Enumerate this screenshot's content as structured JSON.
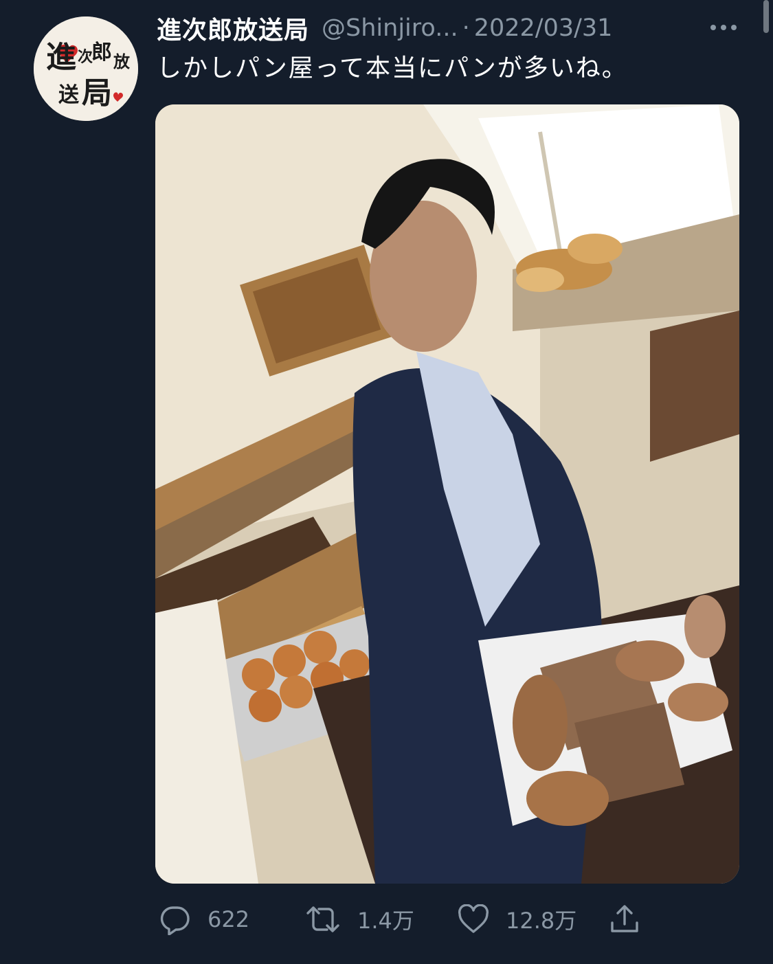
{
  "tweet": {
    "display_name": "進次郎放送局",
    "handle": "@Shinjiro...",
    "separator": "·",
    "date": "2022/03/31",
    "text": "しかしパン屋って本当にパンが多いね。"
  },
  "avatar": {
    "icon": "profile-avatar",
    "chars": [
      "進",
      "次",
      "郎",
      "放",
      "送",
      "局"
    ]
  },
  "actions": {
    "reply_count": "622",
    "retweet_count": "1.4万",
    "like_count": "12.8万"
  },
  "icons": {
    "more": "more-icon",
    "reply": "reply-icon",
    "retweet": "retweet-icon",
    "like": "like-icon",
    "share": "share-icon"
  },
  "colors": {
    "background": "#141d2b",
    "secondary_text": "#8b98a5",
    "avatar_red": "#d22a2a"
  }
}
